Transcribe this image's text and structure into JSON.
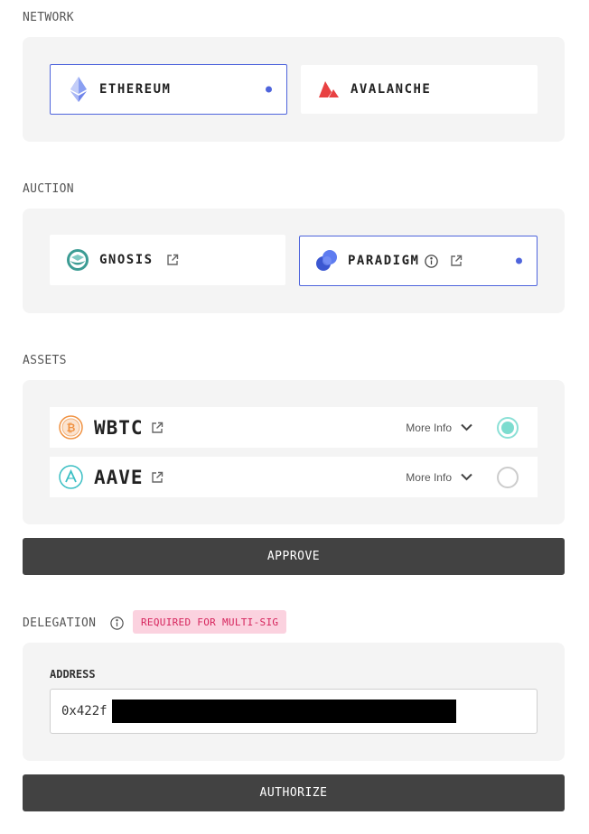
{
  "network": {
    "label": "NETWORK",
    "options": [
      {
        "label": "ETHEREUM",
        "icon": "ethereum-icon",
        "selected": true
      },
      {
        "label": "AVALANCHE",
        "icon": "avalanche-icon",
        "selected": false
      }
    ]
  },
  "auction": {
    "label": "AUCTION",
    "options": [
      {
        "label": "GNOSIS",
        "icon": "gnosis-icon",
        "selected": false
      },
      {
        "label": "PARADIGM",
        "icon": "paradigm-icon",
        "selected": true
      }
    ]
  },
  "assets": {
    "label": "ASSETS",
    "items": [
      {
        "name": "WBTC",
        "more_info": "More Info",
        "selected": true
      },
      {
        "name": "AAVE",
        "more_info": "More Info",
        "selected": false
      }
    ]
  },
  "approve_button": "APPROVE",
  "delegation": {
    "label": "DELEGATION",
    "badge": "REQUIRED FOR MULTI-SIG",
    "address_label": "ADDRESS",
    "address_value": "0x422f"
  },
  "authorize_button": "AUTHORIZE",
  "colors": {
    "accent": "#4e64dc",
    "radio_checked": "#7ddccf",
    "badge_bg": "#fbd2df",
    "badge_text": "#d6245c",
    "button_bg": "#424242"
  }
}
